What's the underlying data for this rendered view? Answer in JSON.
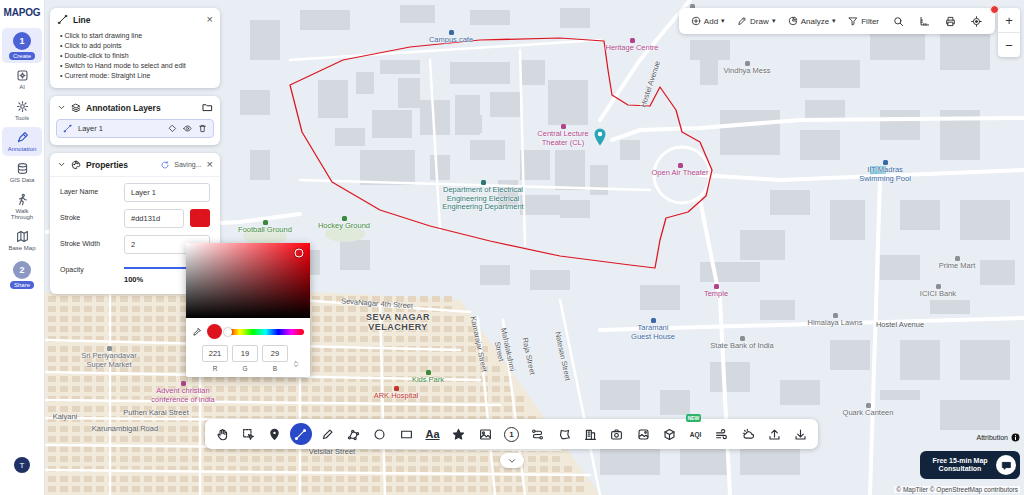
{
  "app": {
    "logo": "MAPOG"
  },
  "rail": {
    "items": [
      {
        "label": "Create",
        "badge": "1",
        "kind": "step",
        "selected": true
      },
      {
        "label": "AI",
        "kind": "tool",
        "selected": false
      },
      {
        "label": "Tools",
        "kind": "tool",
        "selected": false
      },
      {
        "label": "Annotation",
        "kind": "tool",
        "selected": true
      },
      {
        "label": "GIS Data",
        "kind": "tool",
        "selected": false
      },
      {
        "label": "Walk Through",
        "kind": "tool",
        "selected": false
      },
      {
        "label": "Base Map",
        "kind": "tool",
        "selected": false
      },
      {
        "label": "Share",
        "badge": "2",
        "kind": "step",
        "selected": false
      }
    ],
    "avatar": "T"
  },
  "help_panel": {
    "title": "Line",
    "close": "×",
    "lines": [
      "• Click to start drawing line",
      "• Click to add points",
      "• Double-click to finish",
      "• Switch to Hand mode to select and edit",
      "• Current mode: Straight Line"
    ]
  },
  "layers_panel": {
    "title": "Annotation Layers",
    "layers": [
      {
        "name": "Layer 1",
        "selected": true
      }
    ]
  },
  "properties": {
    "title": "Properties",
    "status": "Saving...",
    "close": "×",
    "fields": [
      {
        "label": "Layer Name",
        "value": "Layer 1",
        "kind": "text"
      },
      {
        "label": "Stroke",
        "value": "#dd131d",
        "kind": "color",
        "color": "#dd131d"
      },
      {
        "label": "Stroke Width",
        "value": "2",
        "kind": "text"
      },
      {
        "label": "Opacity",
        "value": "100%",
        "kind": "slider",
        "level": 1
      }
    ]
  },
  "color_picker": {
    "color": "#dd131d",
    "hue_level": 0.01,
    "channels": [
      {
        "value": "221",
        "label": "R"
      },
      {
        "value": "19",
        "label": "G"
      },
      {
        "value": "29",
        "label": "B"
      }
    ]
  },
  "toolbar": {
    "items": [
      {
        "label": "Add",
        "caret": "▾"
      },
      {
        "label": "Draw",
        "caret": "▾"
      },
      {
        "label": "Analyze",
        "caret": "▾"
      },
      {
        "label": "Filter"
      }
    ],
    "notification": true
  },
  "zoom": {
    "in": "+",
    "out": "−"
  },
  "bottom_tools": [
    {
      "kind": "icon",
      "selected": false
    },
    {
      "kind": "icon",
      "selected": false
    },
    {
      "kind": "icon",
      "selected": false
    },
    {
      "kind": "icon",
      "selected": true
    },
    {
      "kind": "icon",
      "selected": false
    },
    {
      "kind": "icon",
      "selected": false
    },
    {
      "kind": "icon",
      "selected": false
    },
    {
      "kind": "icon",
      "selected": false
    },
    {
      "kind": "text",
      "text": "Aa",
      "selected": false
    },
    {
      "kind": "icon",
      "selected": false
    },
    {
      "kind": "icon",
      "selected": false
    },
    {
      "kind": "number",
      "text": "1",
      "selected": false
    },
    {
      "kind": "icon",
      "selected": false
    },
    {
      "kind": "icon",
      "selected": false
    },
    {
      "kind": "icon",
      "selected": false
    },
    {
      "kind": "icon",
      "selected": false
    },
    {
      "kind": "icon",
      "selected": false
    },
    {
      "kind": "icon",
      "selected": false
    },
    {
      "kind": "small",
      "text": "AQI",
      "badge": "NEW",
      "selected": false
    },
    {
      "kind": "icon",
      "selected": false
    },
    {
      "kind": "icon",
      "selected": false
    },
    {
      "kind": "icon",
      "selected": false
    },
    {
      "kind": "icon",
      "selected": false
    }
  ],
  "map": {
    "labels": [
      {
        "text": "Caf",
        "kind": "shop"
      },
      {
        "text": "Campus cafe",
        "kind": "lodging"
      },
      {
        "text": "Heritage Centre",
        "kind": "landmark"
      },
      {
        "text": "Hostel Avenue",
        "kind": "road"
      },
      {
        "text": "Vindhya Mess",
        "kind": "shop"
      },
      {
        "text": "Central Lecture Theater (CL)",
        "kind": "landmark"
      },
      {
        "text": "Open Air Theater",
        "kind": "landmark"
      },
      {
        "text": "IIT Madras Swimming Pool",
        "kind": "lodging"
      },
      {
        "text": "Department of Electrical Engineering Electrical Engineering Department",
        "kind": "education"
      },
      {
        "text": "Football Ground",
        "kind": "sport"
      },
      {
        "text": "Hockey Ground",
        "kind": "sport"
      },
      {
        "text": "Prime Mart",
        "kind": "shop"
      },
      {
        "text": "ICICI Bank",
        "kind": "shop"
      },
      {
        "text": "Temple",
        "kind": "landmark"
      },
      {
        "text": "Himalaya Lawns",
        "kind": "shop"
      },
      {
        "text": "Hostel Avenue",
        "kind": "road"
      },
      {
        "text": "Taramani Guest House",
        "kind": "lodging"
      },
      {
        "text": "State Bank of India",
        "kind": "shop"
      },
      {
        "text": "Quark Canteen",
        "kind": "shop"
      },
      {
        "text": "SevaNagar 4th Street",
        "kind": "road"
      },
      {
        "text": "SEVA NAGAR VELACHERY",
        "kind": "area"
      },
      {
        "text": "Sri Periyandavar Super Market",
        "kind": "shop"
      },
      {
        "text": "Advent christian conference of india",
        "kind": "landmark"
      },
      {
        "text": "Kids Park",
        "kind": "sport"
      },
      {
        "text": "ARK Hospital",
        "kind": "health"
      },
      {
        "text": "Puthen Karai Street",
        "kind": "road"
      },
      {
        "text": "Karunambigai Road",
        "kind": "road"
      },
      {
        "text": "Kalyani",
        "kind": "road"
      },
      {
        "text": "Velsilar Street",
        "kind": "road"
      },
      {
        "text": "Kamarajar Street",
        "kind": "road"
      },
      {
        "text": "Mahalakshmi Street",
        "kind": "road"
      },
      {
        "text": "Raja Street",
        "kind": "road"
      },
      {
        "text": "Natesan Street",
        "kind": "road"
      }
    ]
  },
  "consult": {
    "label": "Free 15-min Map Consultation"
  },
  "attribution": "Attribution",
  "credits": "© MapTiler © OpenStreetMap contributors"
}
